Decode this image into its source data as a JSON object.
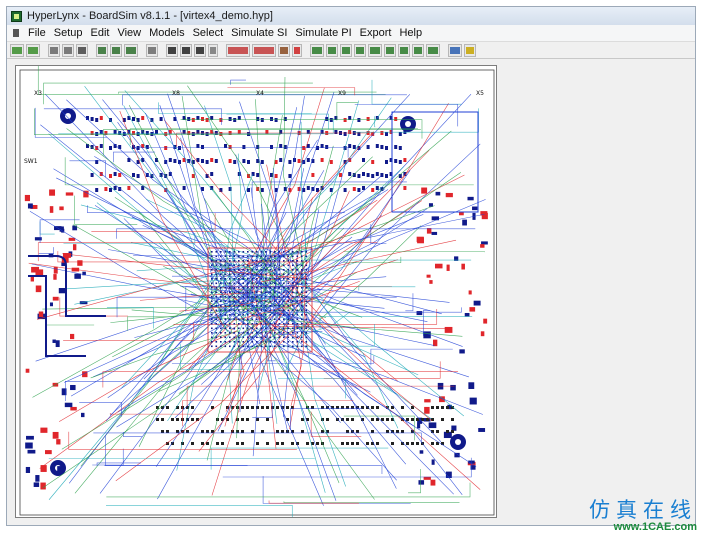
{
  "window": {
    "title": "HyperLynx - BoardSim v8.1.1 - [virtex4_demo.hyp]"
  },
  "menu": [
    {
      "label": "File",
      "name": "menu-file"
    },
    {
      "label": "Setup",
      "name": "menu-setup"
    },
    {
      "label": "Edit",
      "name": "menu-edit"
    },
    {
      "label": "View",
      "name": "menu-view"
    },
    {
      "label": "Models",
      "name": "menu-models"
    },
    {
      "label": "Select",
      "name": "menu-select"
    },
    {
      "label": "Simulate SI",
      "name": "menu-simulate-si"
    },
    {
      "label": "Simulate PI",
      "name": "menu-simulate-pi"
    },
    {
      "label": "Export",
      "name": "menu-export"
    },
    {
      "label": "Help",
      "name": "menu-help"
    }
  ],
  "toolbar": [
    {
      "name": "open-pcb-icon",
      "color": "#3a8d2c"
    },
    {
      "name": "open-bsw-icon",
      "color": "#3a8d2c"
    },
    {
      "name": "board-wizard-icon",
      "color": "#666666"
    },
    {
      "name": "edit-stackup-icon",
      "color": "#666666"
    },
    {
      "name": "library-icon",
      "color": "#444444"
    },
    {
      "name": "layer-icon",
      "color": "#2d6e2d"
    },
    {
      "name": "layer-2-icon",
      "color": "#2d6e2d"
    },
    {
      "name": "board-view-icon",
      "color": "#2d6e2d"
    },
    {
      "name": "select-net-icon",
      "color": "#6a6a6a"
    },
    {
      "name": "zoom-in-icon",
      "color": "#222222"
    },
    {
      "name": "zoom-out-icon",
      "color": "#222222"
    },
    {
      "name": "zoom-fit-icon",
      "color": "#222222"
    },
    {
      "name": "grid-icon",
      "color": "#777777"
    },
    {
      "name": "signal-integrity-icon",
      "color": "#c23a3a"
    },
    {
      "name": "crosstalk-icon",
      "color": "#c23a3a"
    },
    {
      "name": "probe-icon",
      "color": "#8a4a20"
    },
    {
      "name": "terminator-wizard-icon",
      "color": "#cc2222"
    },
    {
      "name": "oscilloscope-icon",
      "color": "#2a7a2a"
    },
    {
      "name": "eye-diagram-icon",
      "color": "#2a7a2a"
    },
    {
      "name": "spectrum-icon",
      "color": "#2a7a2a"
    },
    {
      "name": "batch-icon",
      "color": "#2a7a2a"
    },
    {
      "name": "report-icon",
      "color": "#2a7a2a"
    },
    {
      "name": "sweep-icon",
      "color": "#2a7a2a"
    },
    {
      "name": "pi-decoupling-icon",
      "color": "#2a7a2a"
    },
    {
      "name": "pi-analysis-icon",
      "color": "#2a7a2a"
    },
    {
      "name": "pi-dc-drop-icon",
      "color": "#2a7a2a"
    },
    {
      "name": "hand-icon",
      "color": "#2b5fb0"
    },
    {
      "name": "help-icon",
      "color": "#c7a400"
    }
  ],
  "board": {
    "ref_labels": [
      "X3",
      "X8",
      "X4",
      "X9",
      "X5",
      "SW1"
    ]
  },
  "colors": {
    "trace_blue": "#1f3fd6",
    "trace_red": "#e0262b",
    "trace_cyan": "#17a7b5",
    "trace_green": "#2aa04a",
    "pad_dark": "#101a8a"
  },
  "watermark": {
    "cn_text": "仿真在线",
    "url": "www.1CAE.com"
  }
}
